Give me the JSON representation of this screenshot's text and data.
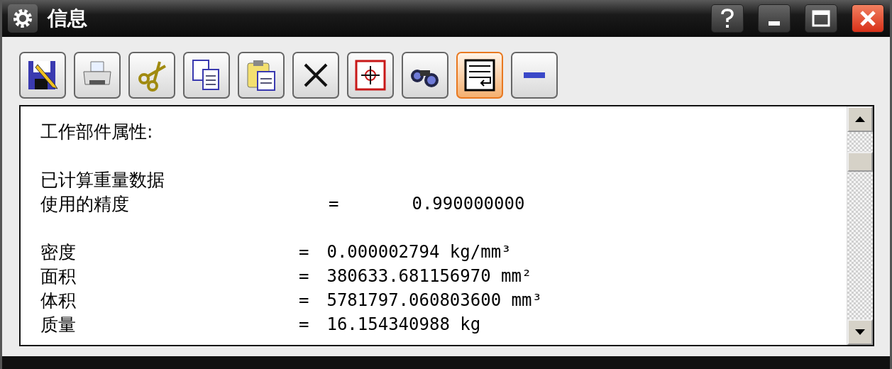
{
  "window": {
    "title": "信息"
  },
  "toolbar": [
    {
      "kind": "save",
      "on": false
    },
    {
      "kind": "print",
      "on": false
    },
    {
      "kind": "cut",
      "on": false
    },
    {
      "kind": "copy",
      "on": false
    },
    {
      "kind": "paste",
      "on": false
    },
    {
      "kind": "delete",
      "on": false
    },
    {
      "kind": "target",
      "on": false
    },
    {
      "kind": "find",
      "on": false
    },
    {
      "kind": "wrap",
      "on": true
    },
    {
      "kind": "minus",
      "on": false
    }
  ],
  "content": {
    "lines": [
      {
        "kind": "text",
        "gap_before": false,
        "text": "工作部件属性:"
      },
      {
        "kind": "text",
        "gap_before": true,
        "text": "已计算重量数据"
      },
      {
        "kind": "wide",
        "gap_before": false,
        "label": "使用的精度",
        "equals": "=",
        "value": "0.990000000"
      },
      {
        "kind": "row",
        "gap_before": true,
        "label": "密度",
        "equals": "=",
        "value": "0.000002794 kg/mm³"
      },
      {
        "kind": "row",
        "gap_before": false,
        "label": "面积",
        "equals": "=",
        "value": "380633.681156970 mm²"
      },
      {
        "kind": "row",
        "gap_before": false,
        "label": "体积",
        "equals": "=",
        "value": "5781797.060803600 mm³"
      },
      {
        "kind": "row",
        "gap_before": false,
        "label": "质量",
        "equals": "=",
        "value": "16.154340988 kg"
      }
    ]
  }
}
